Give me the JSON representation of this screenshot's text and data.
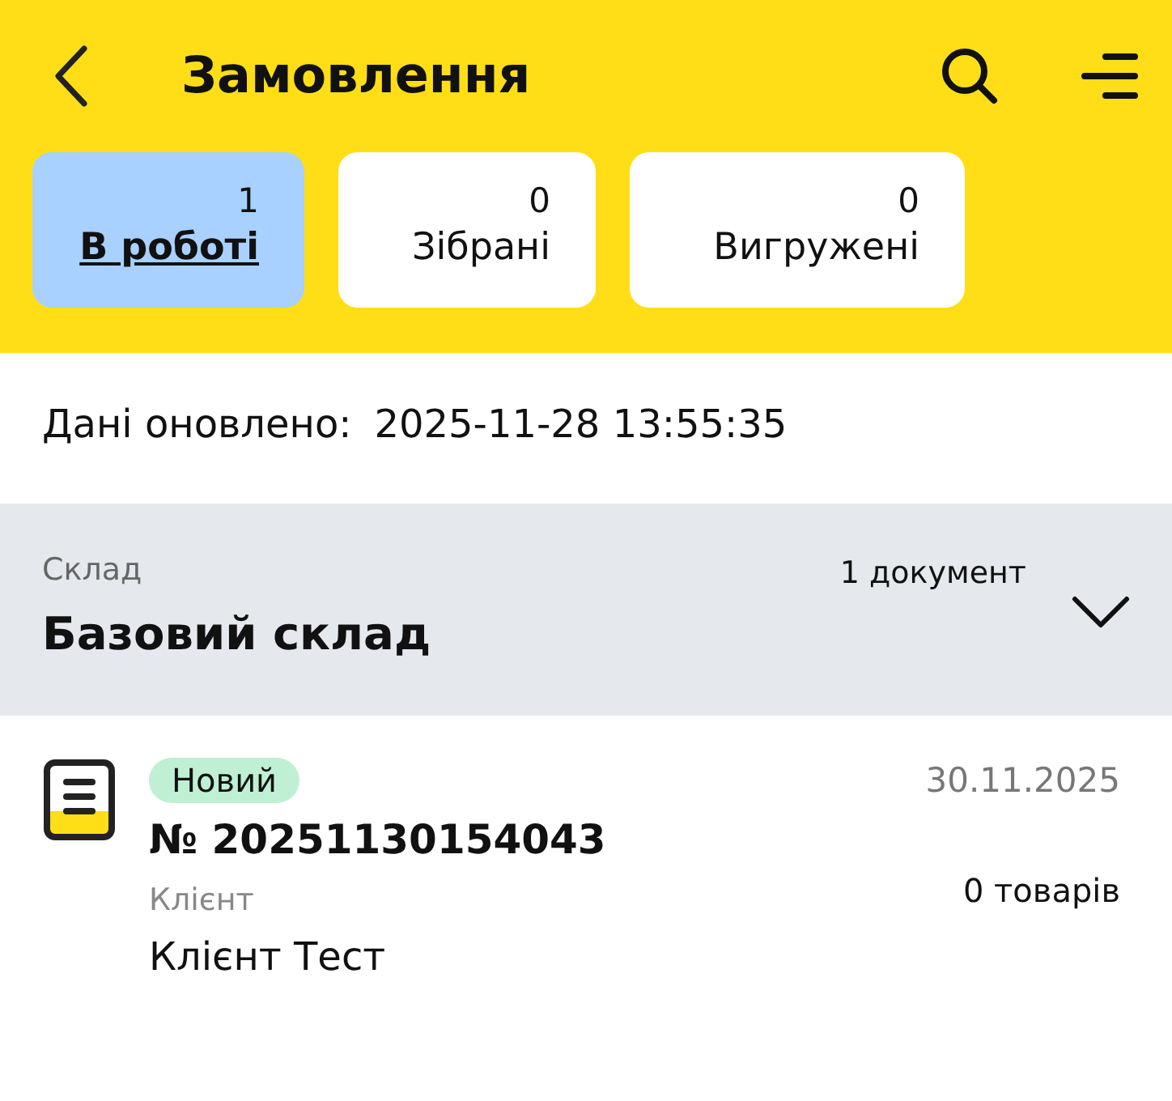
{
  "header": {
    "title": "Замовлення"
  },
  "tabs": [
    {
      "count": "1",
      "label": "В роботі",
      "selected": true
    },
    {
      "count": "0",
      "label": "Зібрані",
      "selected": false
    },
    {
      "count": "0",
      "label": "Вигружені",
      "selected": false
    }
  ],
  "updated": {
    "label": "Дані оновлено:",
    "value": "2025-11-28 13:55:35"
  },
  "warehouse": {
    "label": "Склад",
    "name": "Базовий склад",
    "count": "1 документ",
    "expanded": false
  },
  "orders": [
    {
      "status": "Новий",
      "date": "30.11.2025",
      "number": "№ 20251130154043",
      "client_label": "Клієнт",
      "client": "Клієнт Тест",
      "items": "0 товарів"
    }
  ]
}
